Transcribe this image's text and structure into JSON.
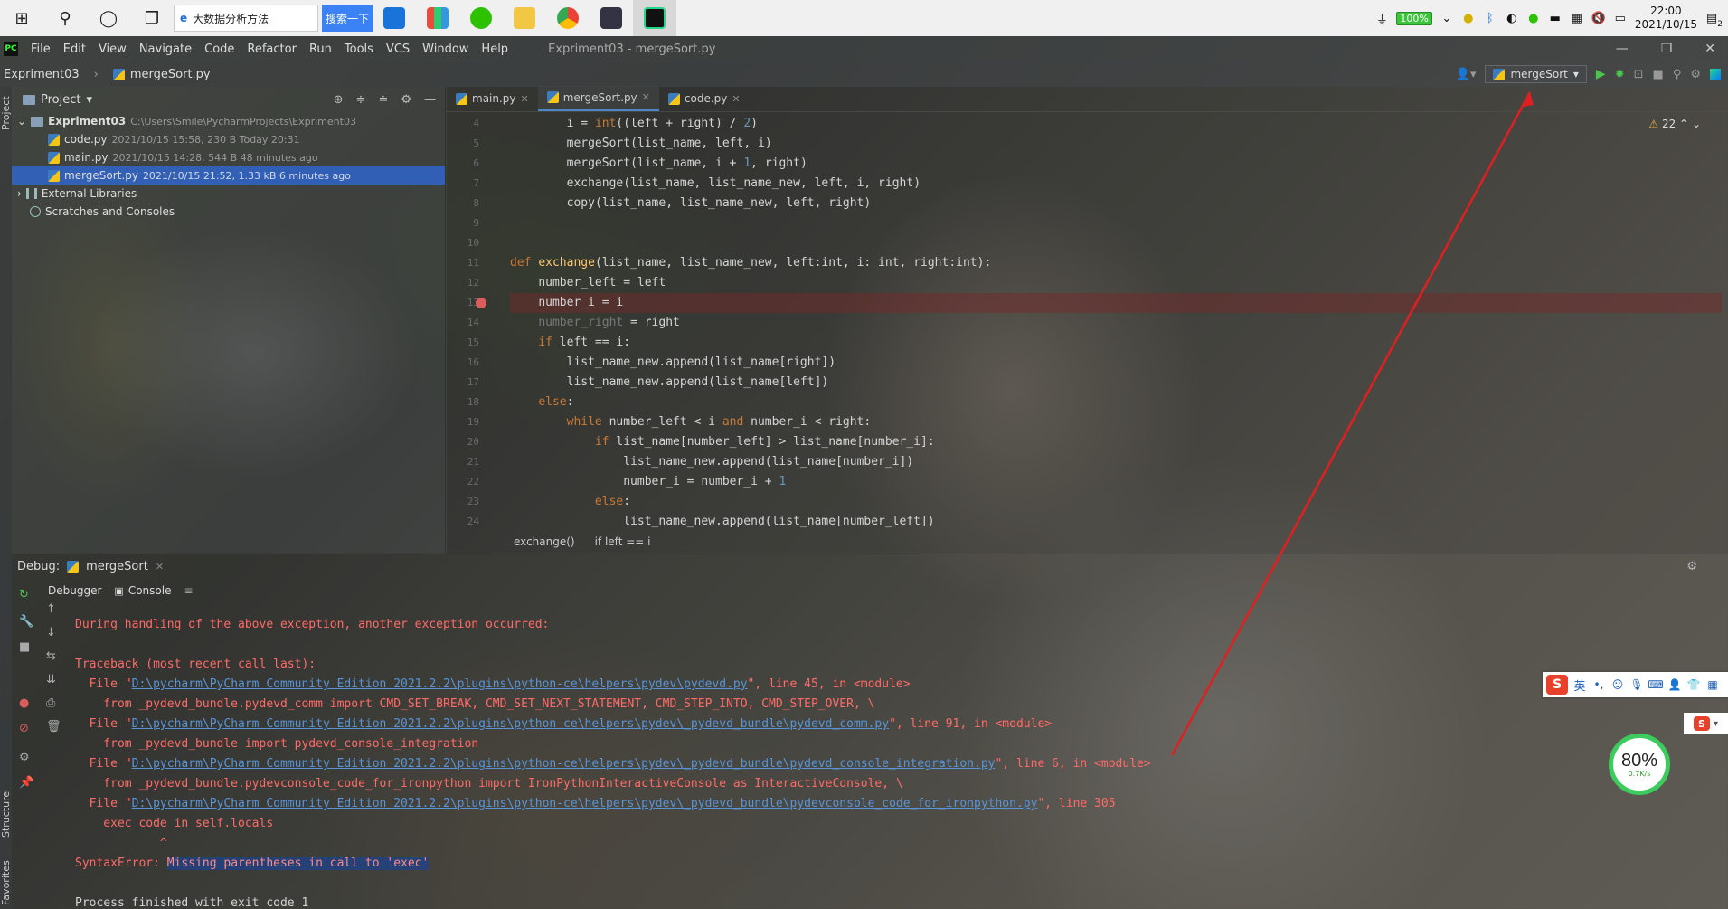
{
  "taskbar": {
    "search_text": "大数据分析方法",
    "search_button": "搜索一下",
    "battery": "100%",
    "time": "22:00",
    "date": "2021/10/15",
    "notify_count": "2"
  },
  "menubar": {
    "items": [
      "File",
      "Edit",
      "View",
      "Navigate",
      "Code",
      "Refactor",
      "Run",
      "Tools",
      "VCS",
      "Window",
      "Help"
    ],
    "window_title": "Expriment03 - mergeSort.py"
  },
  "navbar": {
    "project": "Expriment03",
    "file": "mergeSort.py",
    "run_config": "mergeSort"
  },
  "project_panel": {
    "title": "Project",
    "root": "Expriment03",
    "root_path": "C:\\Users\\Smile\\PycharmProjects\\Expriment03",
    "files": [
      {
        "name": "code.py",
        "meta": "2021/10/15 15:58, 230 B Today 20:31"
      },
      {
        "name": "main.py",
        "meta": "2021/10/15 14:28, 544 B 48 minutes ago"
      },
      {
        "name": "mergeSort.py",
        "meta": "2021/10/15 21:52, 1.33 kB 6 minutes ago"
      }
    ],
    "external": "External Libraries",
    "scratches": "Scratches and Consoles"
  },
  "editor": {
    "tabs": [
      "main.py",
      "mergeSort.py",
      "code.py"
    ],
    "warning_count": "22",
    "line_numbers": [
      "4",
      "5",
      "6",
      "7",
      "8",
      "9",
      "10",
      "11",
      "12",
      "13",
      "14",
      "15",
      "16",
      "17",
      "18",
      "19",
      "20",
      "21",
      "22",
      "23",
      "24"
    ],
    "lines": [
      "        i = int((left + right) / 2)",
      "        mergeSort(list_name, left, i)",
      "        mergeSort(list_name, i + 1, right)",
      "        exchange(list_name, list_name_new, left, i, right)",
      "        copy(list_name, list_name_new, left, right)",
      "",
      "",
      "def exchange(list_name, list_name_new, left:int, i: int, right:int):",
      "    number_left = left",
      "    number_i = i",
      "    number_right = right",
      "    if left == i:",
      "        list_name_new.append(list_name[right])",
      "        list_name_new.append(list_name[left])",
      "    else:",
      "        while number_left < i and number_i < right:",
      "            if list_name[number_left] > list_name[number_i]:",
      "                list_name_new.append(list_name[number_i])",
      "                number_i = number_i + 1",
      "            else:",
      "                list_name_new.append(list_name[number_left])"
    ],
    "breadcrumb": [
      "exchange()",
      "if left == i"
    ]
  },
  "debug": {
    "label": "Debug:",
    "session": "mergeSort",
    "tabs": [
      "Debugger",
      "Console"
    ],
    "lines": [
      {
        "text": "During handling of the above exception, another exception occurred:"
      },
      {
        "text": ""
      },
      {
        "text": "Traceback (most recent call last):"
      },
      {
        "pre": "  File \"",
        "link": "D:\\pycharm\\PyCharm Community Edition 2021.2.2\\plugins\\python-ce\\helpers\\pydev\\pydevd.py",
        "post": "\", line 45, in <module>"
      },
      {
        "text": "    from _pydevd_bundle.pydevd_comm import CMD_SET_BREAK, CMD_SET_NEXT_STATEMENT, CMD_STEP_INTO, CMD_STEP_OVER, \\"
      },
      {
        "pre": "  File \"",
        "link": "D:\\pycharm\\PyCharm Community Edition 2021.2.2\\plugins\\python-ce\\helpers\\pydev\\_pydevd_bundle\\pydevd_comm.py",
        "post": "\", line 91, in <module>"
      },
      {
        "text": "    from _pydevd_bundle import pydevd_console_integration"
      },
      {
        "pre": "  File \"",
        "link": "D:\\pycharm\\PyCharm Community Edition 2021.2.2\\plugins\\python-ce\\helpers\\pydev\\_pydevd_bundle\\pydevd_console_integration.py",
        "post": "\", line 6, in <module>"
      },
      {
        "text": "    from _pydevd_bundle.pydevconsole_code_for_ironpython import IronPythonInteractiveConsole as InteractiveConsole, \\"
      },
      {
        "pre": "  File \"",
        "link": "D:\\pycharm\\PyCharm Community Edition 2021.2.2\\plugins\\python-ce\\helpers\\pydev\\_pydevd_bundle\\pydevconsole_code_for_ironpython.py",
        "post": "\", line 305"
      },
      {
        "text": "    exec code in self.locals"
      },
      {
        "text": "            ^"
      },
      {
        "pre": "SyntaxError: ",
        "hl": "Missing parentheses in call to 'exec'",
        "post": ""
      },
      {
        "text": ""
      },
      {
        "text": "Process finished with exit code 1",
        "plain": true
      }
    ]
  },
  "widgets": {
    "ime_label": "英",
    "speed_pct": "80%",
    "speed_rate": "0.7K/s"
  },
  "side_labels": {
    "project": "Project",
    "structure": "Structure",
    "favorites": "Favorites"
  },
  "colors": {
    "accent": "#4a88c7",
    "error_text": "#ff6b68",
    "link": "#5894d6",
    "breakpoint": "#db5c5c",
    "annotation_arrow": "#e02020"
  }
}
